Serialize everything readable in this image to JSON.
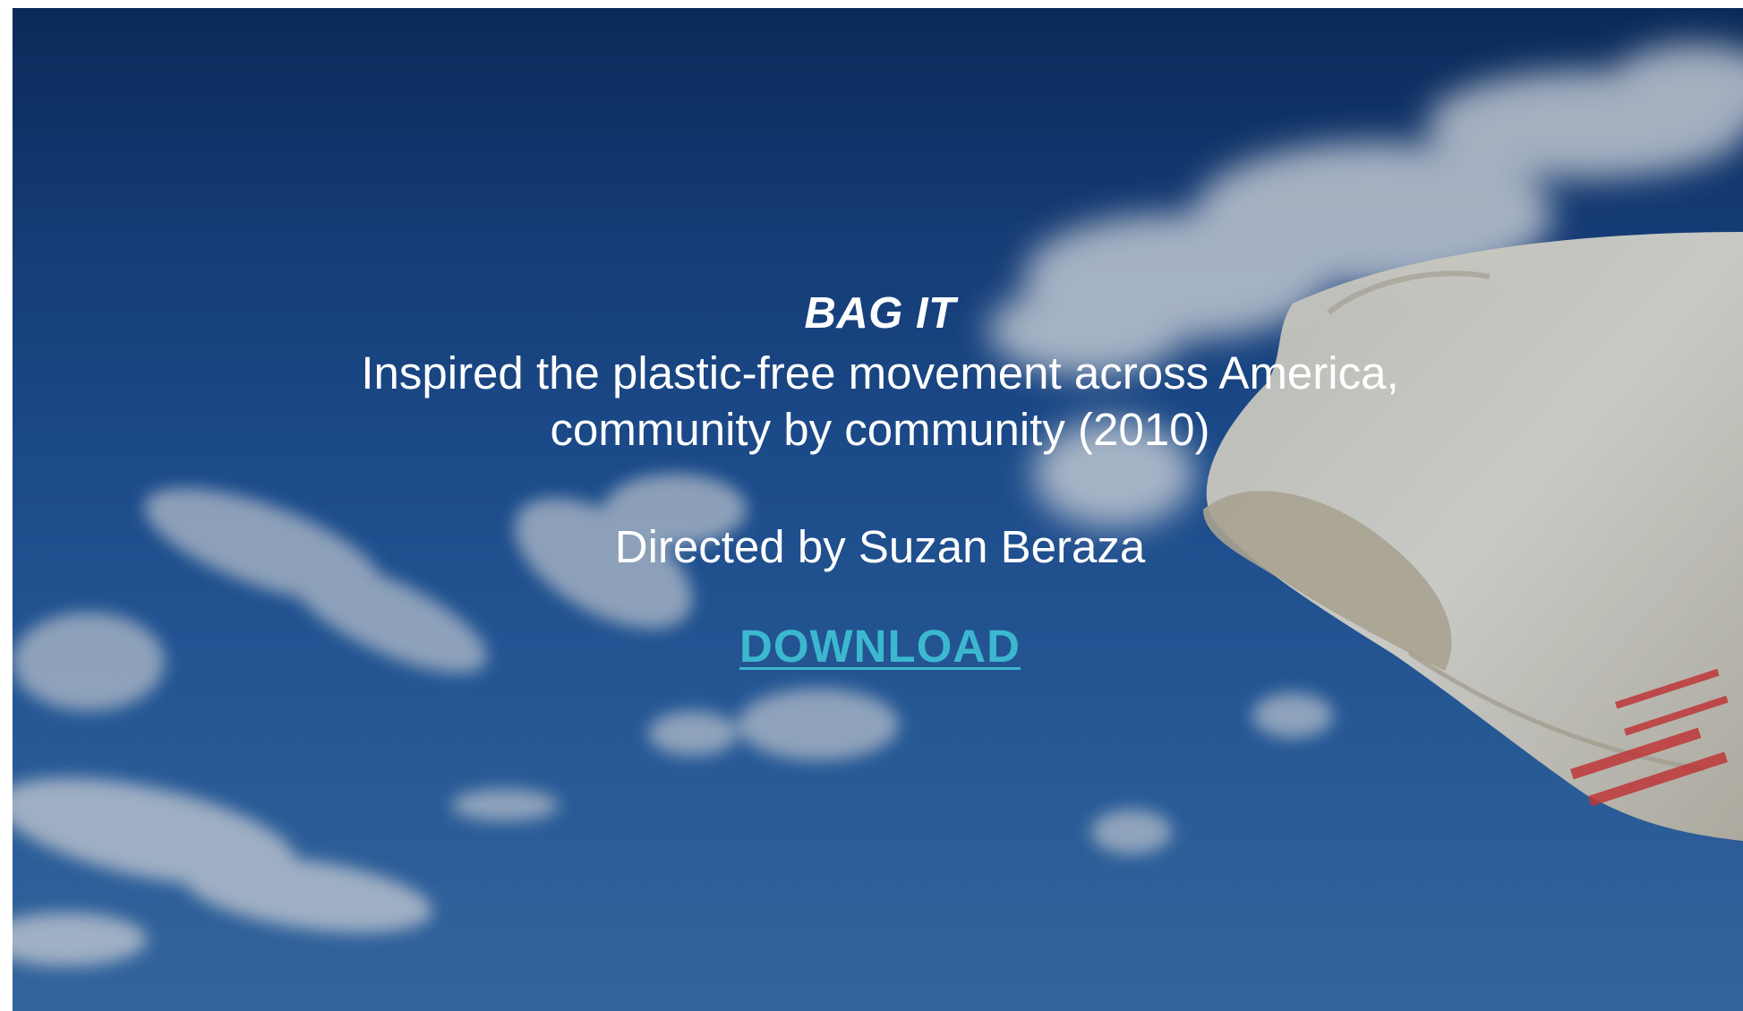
{
  "hero": {
    "background_icon": "sky-with-plastic-bag-image",
    "colors": {
      "sky_dark": "#0b2c5c",
      "sky_light": "#3a6ea8",
      "cloud": "#d8dde3",
      "bag": "#e6e0d2",
      "bag_print": "#d83a36",
      "link": "#3bb8cf"
    }
  },
  "film": {
    "title": "BAG IT",
    "description": "Inspired the plastic-free movement across America, community by community (2010)",
    "director": "Directed by Suzan Beraza"
  },
  "actions": {
    "download_label": "DOWNLOAD"
  }
}
